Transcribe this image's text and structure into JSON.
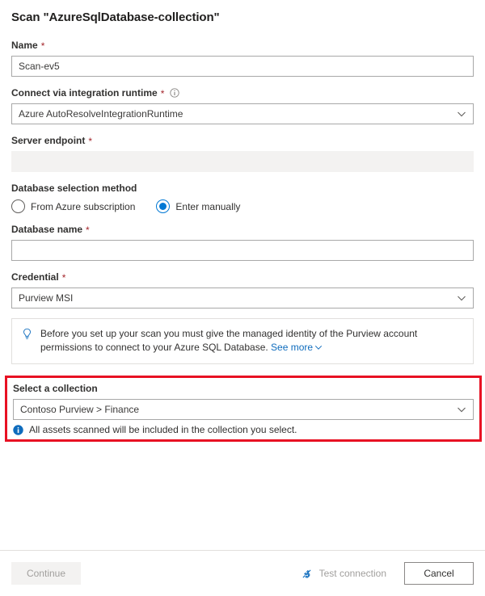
{
  "title": "Scan \"AzureSqlDatabase-collection\"",
  "fields": {
    "name": {
      "label": "Name",
      "required": "*",
      "value": "Scan-ev5",
      "placeholder": ""
    },
    "runtime": {
      "label": "Connect via integration runtime",
      "required": "*",
      "info_icon": "info-circle-icon",
      "value": "Azure AutoResolveIntegrationRuntime"
    },
    "server_endpoint": {
      "label": "Server endpoint",
      "required": "*",
      "value": "",
      "placeholder": ""
    },
    "db_selection": {
      "label": "Database selection method",
      "options": [
        {
          "label": "From Azure subscription",
          "checked": false
        },
        {
          "label": "Enter manually",
          "checked": true
        }
      ]
    },
    "database_name": {
      "label": "Database name",
      "required": "*",
      "value": "",
      "placeholder": ""
    },
    "credential": {
      "label": "Credential",
      "required": "*",
      "value": "Purview MSI"
    },
    "collection": {
      "label": "Select a collection",
      "value": "Contoso Purview > Finance",
      "hint": "All assets scanned will be included in the collection you select.",
      "hint_icon": "info-filled-icon"
    }
  },
  "callout": {
    "icon": "lightbulb-icon",
    "text": "Before you set up your scan you must give the managed identity of the Purview account permissions to connect to your Azure SQL Database.",
    "link_label": "See more",
    "link_chevron": "chevron-down-icon"
  },
  "footer": {
    "continue_label": "Continue",
    "test_connection_label": "Test connection",
    "test_connection_icon": "plug-icon",
    "cancel_label": "Cancel"
  },
  "colors": {
    "accent": "#0078d4",
    "link": "#0f6cbd",
    "required": "#a4262c",
    "highlight": "#e81123",
    "border": "#a8a8a8",
    "disabled_bg": "#f3f2f1"
  }
}
